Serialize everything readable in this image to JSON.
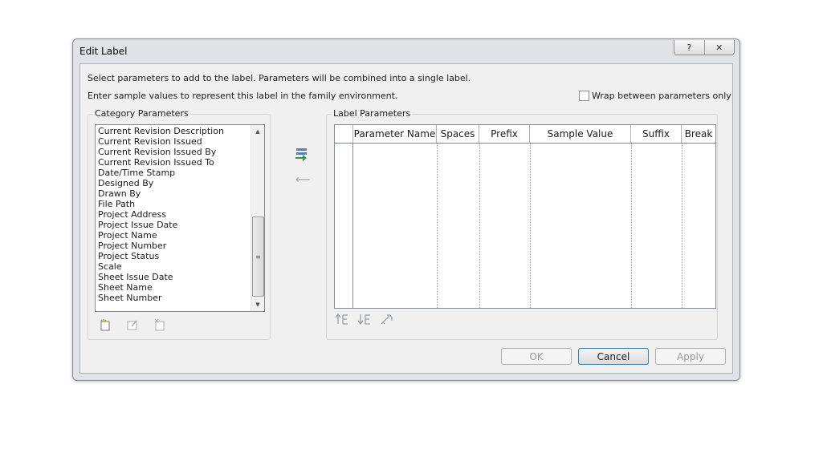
{
  "dialog": {
    "title": "Edit Label",
    "help_icon": "?",
    "close_icon": "✕",
    "intro_line1": "Select parameters to add to the label.  Parameters will be combined into a single label.",
    "intro_line2": "Enter sample values to represent this label in the family environment.",
    "wrap_label": "Wrap between parameters only",
    "wrap_checked": false
  },
  "category": {
    "title": "Category Parameters",
    "items": [
      "Current Revision Description",
      "Current Revision Issued",
      "Current Revision Issued By",
      "Current Revision Issued To",
      "Date/Time Stamp",
      "Designed By",
      "Drawn By",
      "File Path",
      "Project Address",
      "Project Issue Date",
      "Project Name",
      "Project Number",
      "Project Status",
      "Scale",
      "Sheet Issue Date",
      "Sheet Name",
      "Sheet Number"
    ]
  },
  "label": {
    "title": "Label Parameters",
    "columns": [
      "Parameter Name",
      "Spaces",
      "Prefix",
      "Sample Value",
      "Suffix",
      "Break"
    ]
  },
  "buttons": {
    "ok": "OK",
    "cancel": "Cancel",
    "apply": "Apply"
  },
  "icons": {
    "add": "add-parameter-icon",
    "remove": "remove-parameter-icon",
    "new": "new-parameter-icon",
    "edit": "edit-parameter-icon",
    "delete": "delete-parameter-icon",
    "move_up": "move-up-icon",
    "move_down": "move-down-icon",
    "format": "edit-formatting-icon"
  }
}
